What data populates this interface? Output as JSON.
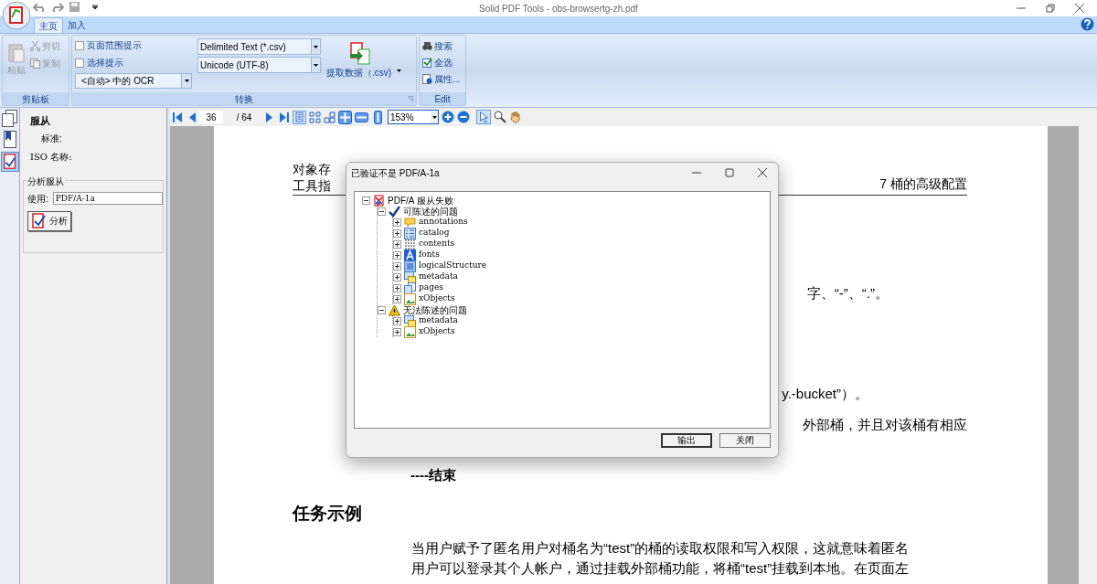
{
  "window": {
    "title": "Solid PDF Tools - obs-browsertg-zh.pdf"
  },
  "tabs": [
    {
      "label": "主页",
      "selected": true
    },
    {
      "label": "加入",
      "selected": false
    }
  ],
  "ribbon": {
    "clipboard": {
      "paste": "粘贴",
      "cut": "剪切",
      "copy": "复制",
      "group": "剪贴板"
    },
    "convert": {
      "checks": [
        {
          "label": "页面范围提示",
          "checked": false
        },
        {
          "label": "选择提示",
          "checked": false
        }
      ],
      "ocr": "<自动> 中的 OCR",
      "format": "Delimited Text (*.csv)",
      "encoding": "Unicode (UTF-8)",
      "extract": "提取数据（.csv)",
      "group": "转换"
    },
    "edit": {
      "items": [
        "搜索",
        "全选",
        "属性..."
      ],
      "group": "Edit"
    }
  },
  "left_panel": {
    "title": "服从",
    "standard_label": "标准:",
    "iso_label": "ISO 名称:",
    "analyze_group": "分析服从",
    "use_label": "使用:",
    "use_value": "PDF/A-1a",
    "analyze_button": "分析"
  },
  "toolbar": {
    "page": "36",
    "pages": "/ 64",
    "zoom": "153%"
  },
  "document": {
    "header_left": [
      "对象存",
      "工具指"
    ],
    "header_right": "7 桶的高级配置",
    "fragments": [
      "字、“-”、“.”。",
      "y.-bucket”）。",
      "外部桶，并且对该桶有相应"
    ],
    "end_text": "----结束",
    "heading": "任务示例",
    "paragraph": [
      "当用户赋予了匿名用户对桶名为“test”的桶的读取权限和写入权限，这就意味着匿名",
      "用户可以登录其个人帐户，通过挂载外部桶功能，将桶“test”挂载到本地。在页面左"
    ]
  },
  "dialog": {
    "title": "已验证不是 PDF/A-1a",
    "tree": [
      {
        "label": "PDF/A 服从失败",
        "kind": "root",
        "expanded": true,
        "children": [
          {
            "label": "可陈述的问题",
            "kind": "check",
            "expanded": true,
            "children": [
              {
                "label": "annotations",
                "kind": "annotation",
                "expanded": false
              },
              {
                "label": "catalog",
                "kind": "list",
                "expanded": false
              },
              {
                "label": "contents",
                "kind": "contents",
                "expanded": false
              },
              {
                "label": "fonts",
                "kind": "font",
                "expanded": false
              },
              {
                "label": "logicalStructure",
                "kind": "structure",
                "expanded": false
              },
              {
                "label": "metadata",
                "kind": "metadata",
                "expanded": false
              },
              {
                "label": "pages",
                "kind": "pages",
                "expanded": false
              },
              {
                "label": "xObjects",
                "kind": "image",
                "expanded": false
              }
            ]
          },
          {
            "label": "无法陈述的问题",
            "kind": "warning",
            "expanded": true,
            "children": [
              {
                "label": "metadata",
                "kind": "metadata",
                "expanded": false
              },
              {
                "label": "xObjects",
                "kind": "image",
                "expanded": false
              }
            ]
          }
        ]
      }
    ],
    "buttons": [
      "输出",
      "关闭"
    ]
  }
}
